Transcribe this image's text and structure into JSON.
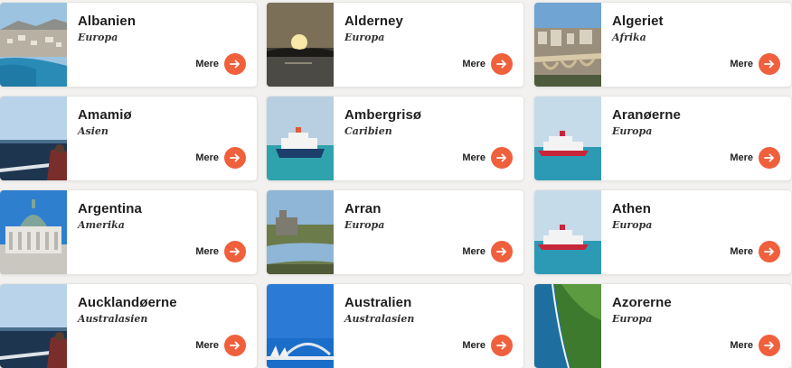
{
  "accent_color": "#f0603d",
  "destinations": [
    {
      "name": "Albanien",
      "region": "Europa",
      "more_label": "Mere",
      "image": "coastal-city-bay"
    },
    {
      "name": "Alderney",
      "region": "Europa",
      "more_label": "Mere",
      "image": "sunset-over-sea"
    },
    {
      "name": "Algeriet",
      "region": "Afrika",
      "more_label": "Mere",
      "image": "city-bridge"
    },
    {
      "name": "Amamiø",
      "region": "Asien",
      "more_label": "Mere",
      "image": "sea-from-ship"
    },
    {
      "name": "Ambergrisø",
      "region": "Caribien",
      "more_label": "Mere",
      "image": "ferry-ship"
    },
    {
      "name": "Aranøerne",
      "region": "Europa",
      "more_label": "Mere",
      "image": "ferry-ship-red"
    },
    {
      "name": "Argentina",
      "region": "Amerika",
      "more_label": "Mere",
      "image": "domed-building"
    },
    {
      "name": "Arran",
      "region": "Europa",
      "more_label": "Mere",
      "image": "castle-river"
    },
    {
      "name": "Athen",
      "region": "Europa",
      "more_label": "Mere",
      "image": "ferry-ship-red"
    },
    {
      "name": "Aucklandøerne",
      "region": "Australasien",
      "more_label": "Mere",
      "image": "sea-from-ship"
    },
    {
      "name": "Australien",
      "region": "Australasien",
      "more_label": "Mere",
      "image": "harbour-bridge-opera"
    },
    {
      "name": "Azorerne",
      "region": "Europa",
      "more_label": "Mere",
      "image": "green-cliffs"
    }
  ]
}
